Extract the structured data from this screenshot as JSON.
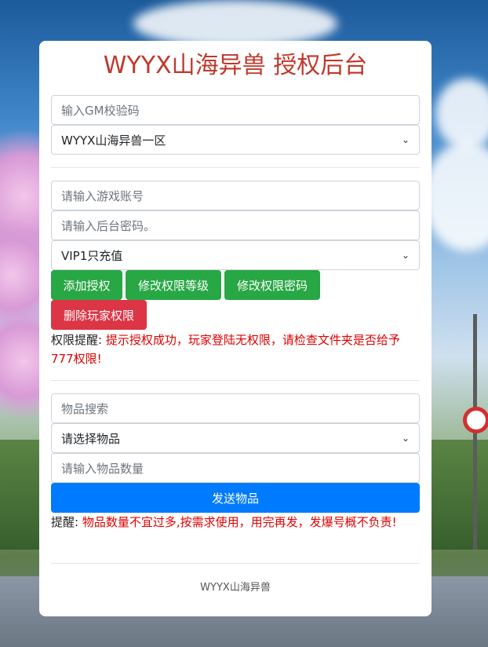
{
  "title": "WYYX山海异兽 授权后台",
  "gm": {
    "placeholder": "输入GM校验码"
  },
  "server_select": {
    "value": "WYYX山海异兽一区"
  },
  "account": {
    "placeholder": "请输入游戏账号"
  },
  "password": {
    "placeholder": "请输入后台密码。"
  },
  "vip_select": {
    "value": "VIP1只充值"
  },
  "buttons": {
    "add": "添加授权",
    "modify_level": "修改权限等级",
    "modify_password": "修改权限密码",
    "delete": "删除玩家权限",
    "send": "发送物品"
  },
  "permission_note": {
    "label": "权限提醒:",
    "text": "提示授权成功，玩家登陆无权限，请检查文件夹是否给予777权限!"
  },
  "item_search": {
    "placeholder": "物品搜索"
  },
  "item_select": {
    "value": "请选择物品"
  },
  "item_qty": {
    "placeholder": "请输入物品数量"
  },
  "item_note": {
    "label": "提醒:",
    "text": "物品数量不宜过多,按需求使用，用完再发，发爆号概不负责!"
  },
  "footer": "WYYX山海异兽",
  "colors": {
    "title": "#c0392b",
    "green": "#28a745",
    "red": "#dc3545",
    "blue": "#007bff",
    "warn": "#e00000"
  }
}
